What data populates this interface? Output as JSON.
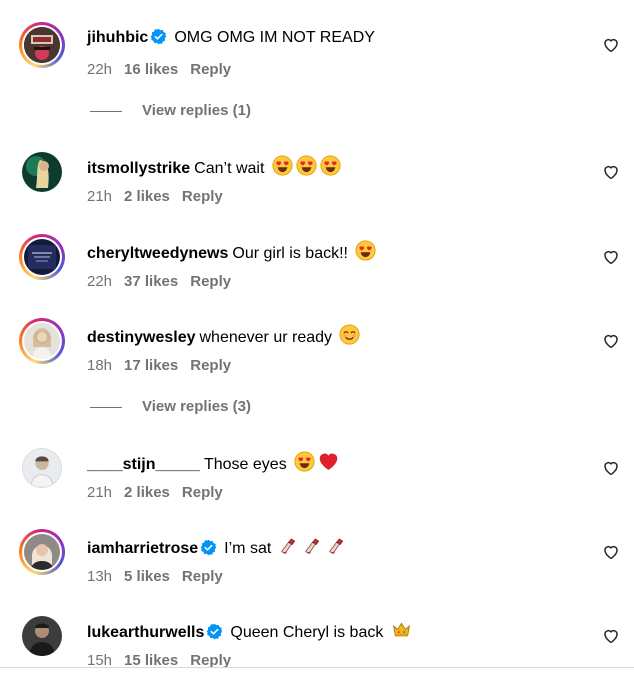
{
  "comments": [
    {
      "username": "jihuhbic",
      "verified": true,
      "text": "OMG OMG IM NOT READY",
      "emojis": [],
      "time": "22h",
      "likes": "16 likes",
      "reply": "Reply"
    },
    {
      "username": "itsmollystrike",
      "verified": false,
      "text": "Can’t wait",
      "emojis": [
        "heart-eyes-emoji",
        "heart-eyes-emoji",
        "heart-eyes-emoji"
      ],
      "time": "21h",
      "likes": "2 likes",
      "reply": "Reply"
    },
    {
      "username": "cheryltweedynews",
      "verified": false,
      "text": "Our girl is back!!",
      "emojis": [
        "heart-eyes-emoji"
      ],
      "time": "22h",
      "likes": "37 likes",
      "reply": "Reply"
    },
    {
      "username": "destinywesley",
      "verified": false,
      "text": "whenever ur ready",
      "emojis": [
        "blush-emoji"
      ],
      "time": "18h",
      "likes": "17 likes",
      "reply": "Reply"
    },
    {
      "username": "____stijn_____",
      "verified": false,
      "text": "Those eyes",
      "emojis": [
        "heart-eyes-emoji",
        "red-heart-emoji"
      ],
      "time": "21h",
      "likes": "2 likes",
      "reply": "Reply"
    },
    {
      "username": "iamharrietrose",
      "verified": true,
      "text": "I’m sat",
      "emojis": [
        "nail-polish-emoji",
        "nail-polish-emoji",
        "nail-polish-emoji"
      ],
      "time": "13h",
      "likes": "5 likes",
      "reply": "Reply"
    },
    {
      "username": "lukearthurwells",
      "verified": true,
      "text": "Queen Cheryl is back",
      "emojis": [
        "crown-emoji"
      ],
      "time": "15h",
      "likes": "15 likes",
      "reply": "Reply"
    }
  ],
  "view_replies": [
    {
      "label": "View replies (1)"
    },
    {
      "label": "View replies (3)"
    }
  ],
  "colors": {
    "text": "#000000",
    "muted": "#737373",
    "verified_blue": "#0095f6",
    "story_ring": [
      "#feda75",
      "#fa7e1e",
      "#d62976",
      "#962fbf",
      "#4f5bd5"
    ]
  }
}
